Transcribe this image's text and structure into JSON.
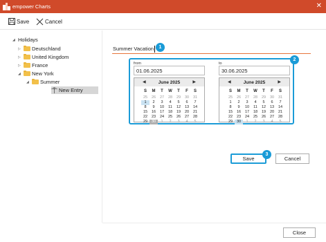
{
  "window": {
    "title": "empower Charts",
    "close_glyph": "✕"
  },
  "toolbar": {
    "save_label": "Save",
    "cancel_label": "Cancel"
  },
  "tree": {
    "root": "Holidays",
    "items": [
      "Deutschland",
      "United Kingdom",
      "France",
      "New York",
      "Summer",
      "New Entry"
    ]
  },
  "form": {
    "name_value": "Summer Vacation",
    "from_label": "from",
    "to_label": "to",
    "from_value": "01.06.2025",
    "to_value": "30.06.2025"
  },
  "calendar": {
    "month_label": "June 2025",
    "prev_glyph": "◀",
    "next_glyph": "▶",
    "days_of_week": [
      "S",
      "M",
      "T",
      "W",
      "T",
      "F",
      "S"
    ],
    "weeks": [
      [
        "25",
        "26",
        "27",
        "28",
        "29",
        "30",
        "31"
      ],
      [
        "1",
        "2",
        "3",
        "4",
        "5",
        "6",
        "7"
      ],
      [
        "8",
        "9",
        "10",
        "11",
        "12",
        "13",
        "14"
      ],
      [
        "15",
        "16",
        "17",
        "18",
        "19",
        "20",
        "21"
      ],
      [
        "22",
        "23",
        "24",
        "25",
        "26",
        "27",
        "28"
      ],
      [
        "29",
        "30",
        "1",
        "2",
        "3",
        "4",
        "5"
      ]
    ]
  },
  "buttons": {
    "save_label": "Save",
    "cancel_label": "Cancel",
    "close_label": "Close"
  },
  "badges": [
    "1",
    "2",
    "3"
  ],
  "colors": {
    "titlebar": "#d04a2a",
    "accent": "#1a9bd7",
    "input_underline": "#e8743b"
  }
}
